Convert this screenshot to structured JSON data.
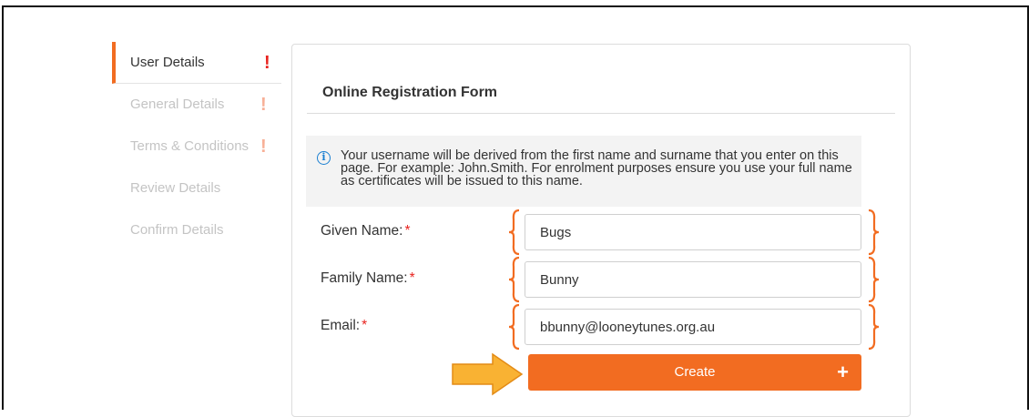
{
  "sidebar": {
    "items": [
      {
        "label": "User Details",
        "warn": "!"
      },
      {
        "label": "General Details",
        "warn": "!"
      },
      {
        "label": "Terms & Conditions",
        "warn": "!"
      },
      {
        "label": "Review Details"
      },
      {
        "label": "Confirm Details"
      }
    ]
  },
  "form": {
    "title": "Online Registration Form",
    "info_icon": "i",
    "info_text": "Your username will be derived from the first name and surname that you enter on this page. For example: John.Smith. For enrolment purposes ensure you use your full name as certificates will be issued to this name.",
    "required_marker": "*",
    "fields": [
      {
        "label": "Given Name:",
        "value": "Bugs"
      },
      {
        "label": "Family Name:",
        "value": "Bunny"
      },
      {
        "label": "Email:",
        "value": "bbunny@looneytunes.org.au"
      }
    ],
    "create_label": "Create",
    "create_icon": "+"
  },
  "colors": {
    "accent": "#f26c21",
    "required": "#e8231f",
    "info": "#1a7fd1",
    "annotation_arrow": "#f9b233"
  },
  "annotations": {
    "brace_icon": "orange-curly-brace",
    "arrow_icon": "yellow-arrow-right"
  }
}
